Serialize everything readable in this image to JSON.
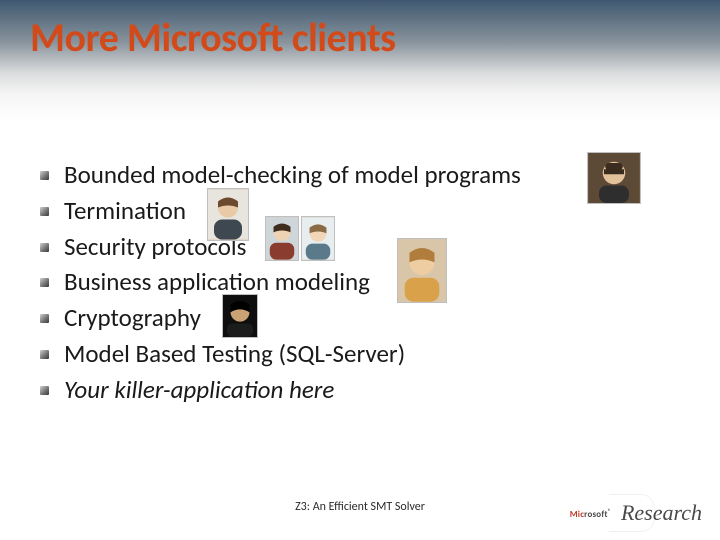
{
  "title": "More Microsoft clients",
  "bullets": [
    {
      "text": "Bounded model-checking of model programs",
      "italic": false
    },
    {
      "text": "Termination",
      "italic": false
    },
    {
      "text": "Security protocols",
      "italic": false
    },
    {
      "text": "Business application modeling",
      "italic": false
    },
    {
      "text": "Cryptography",
      "italic": false
    },
    {
      "text": "Model Based Testing (SQL-Server)",
      "italic": false
    },
    {
      "text": "Your killer-application here",
      "italic": true
    }
  ],
  "footer": "Z3: An Efficient SMT Solver",
  "logo": {
    "brand": "Microsoft",
    "unit": "Research"
  },
  "thumbs": [
    {
      "name": "person-thumb-1"
    },
    {
      "name": "person-thumb-2"
    },
    {
      "name": "person-thumb-3"
    },
    {
      "name": "person-thumb-4"
    },
    {
      "name": "person-thumb-5"
    },
    {
      "name": "person-thumb-6"
    }
  ]
}
